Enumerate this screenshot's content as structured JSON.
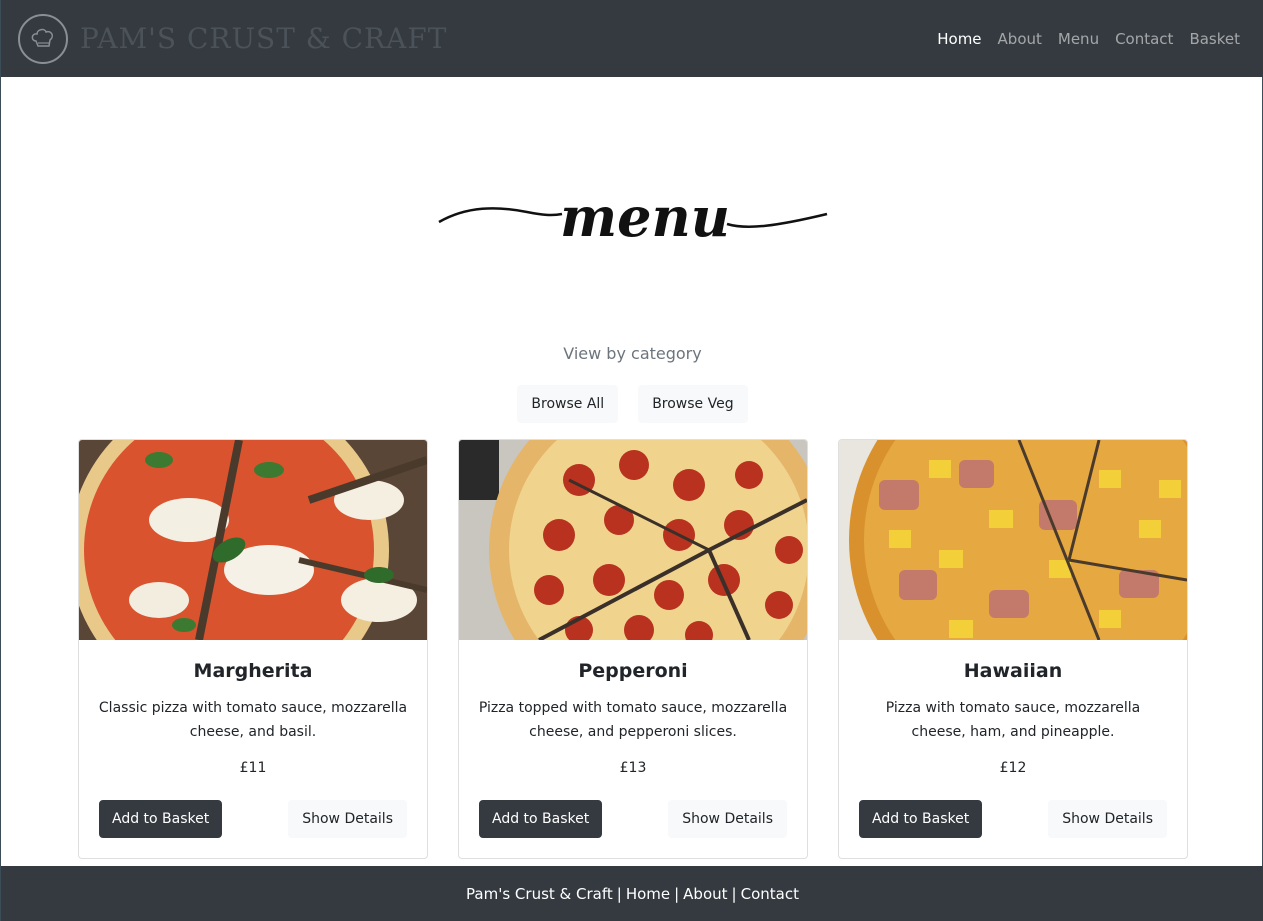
{
  "navbar": {
    "brand": "PAM'S CRUST & CRAFT",
    "logo_icon": "chef-hat-icon",
    "links": [
      "Home",
      "About",
      "Menu",
      "Contact",
      "Basket"
    ],
    "active": "Home"
  },
  "hero": {
    "title": "menu",
    "category_label": "View by category",
    "browse_all": "Browse All",
    "browse_veg": "Browse Veg"
  },
  "menu_items": [
    {
      "name": "Margherita",
      "description": "Classic pizza with tomato sauce, mozzarella cheese, and basil.",
      "price": "£11",
      "add_label": "Add to Basket",
      "details_label": "Show Details"
    },
    {
      "name": "Pepperoni",
      "description": "Pizza topped with tomato sauce, mozzarella cheese, and pepperoni slices.",
      "price": "£13",
      "add_label": "Add to Basket",
      "details_label": "Show Details"
    },
    {
      "name": "Hawaiian",
      "description": "Pizza with tomato sauce, mozzarella cheese, ham, and pineapple.",
      "price": "£12",
      "add_label": "Add to Basket",
      "details_label": "Show Details"
    }
  ],
  "footer": {
    "brand": "Pam's Crust & Craft",
    "links": [
      "Home",
      "About",
      "Contact"
    ],
    "separator": "|"
  }
}
